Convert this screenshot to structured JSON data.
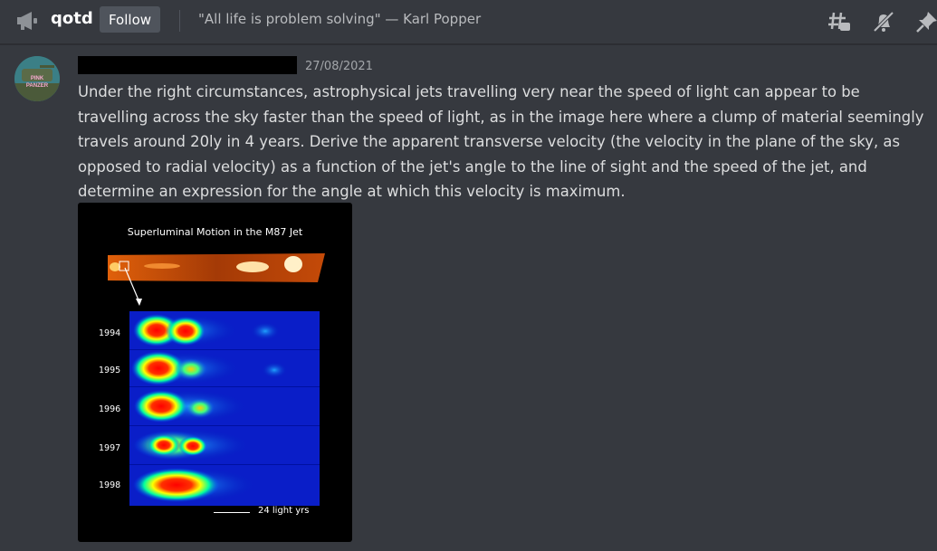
{
  "header": {
    "channel_icon": "announcement-megaphone-icon",
    "channel_name": "qotd",
    "follow_label": "Follow",
    "topic": "\"All life is problem solving\" — Karl Popper",
    "icons": [
      "threads-icon",
      "mute-notifications-icon",
      "pinned-messages-icon"
    ]
  },
  "message": {
    "avatar_text": "PINK PANZER",
    "timestamp": "27/08/2021",
    "text": "Under the right circumstances, astrophysical jets travelling very near the speed of light can appear to be travelling across the sky faster than the speed of light, as in the image here where a clump of material seemingly travels around 20ly in 4 years. Derive the apparent transverse velocity (the velocity in the plane of the sky, as opposed to radial velocity) as a function of the jet's angle to the line of sight and the speed of the jet, and determine an expression for the angle at which this velocity is maximum."
  },
  "attachment": {
    "title": "Superluminal Motion in the M87 Jet",
    "years": [
      "1994",
      "1995",
      "1996",
      "1997",
      "1998"
    ],
    "scale_label": "24 light yrs"
  },
  "colors": {
    "background": "#36393f",
    "text": "#dcddde",
    "follow_button": "#4f545c"
  }
}
